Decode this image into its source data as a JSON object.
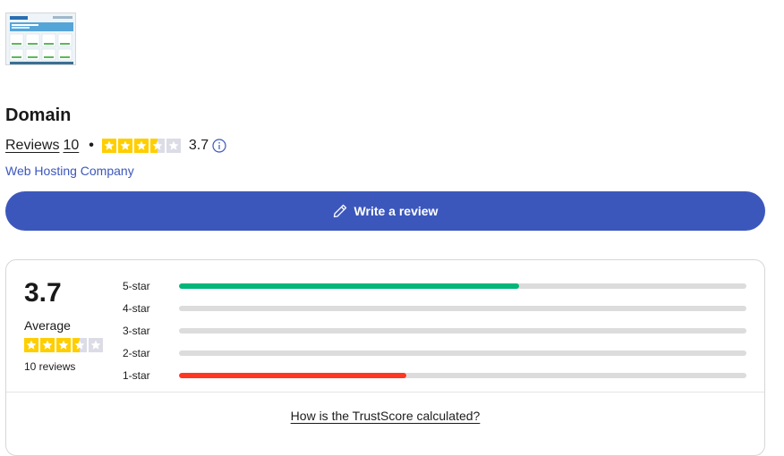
{
  "company": {
    "name": "Domain",
    "reviews_label": "Reviews",
    "reviews_count": "10",
    "separator": "•",
    "rating": "3.7",
    "stars": 3.5,
    "category": "Web Hosting Company"
  },
  "actions": {
    "write_review_label": "Write a review"
  },
  "summary": {
    "score": "3.7",
    "score_label": "Average",
    "reviews_text": "10 reviews",
    "stars": 3.5,
    "distribution": [
      {
        "label": "5-star",
        "fraction": 0.6,
        "color": "#00b67a"
      },
      {
        "label": "4-star",
        "fraction": 0,
        "color": "#73cf11"
      },
      {
        "label": "3-star",
        "fraction": 0,
        "color": "#ffce00"
      },
      {
        "label": "2-star",
        "fraction": 0,
        "color": "#ff8622"
      },
      {
        "label": "1-star",
        "fraction": 0.4,
        "color": "#ff3722"
      }
    ],
    "trustscore_link": "How is the TrustScore calculated?"
  },
  "colors": {
    "accent": "#3c57bc",
    "star_filled": "#ffce00",
    "star_empty": "#dcdce6"
  },
  "icons": [
    "company-screenshot-thumbnail",
    "info-icon",
    "pencil-icon",
    "star-icon"
  ]
}
